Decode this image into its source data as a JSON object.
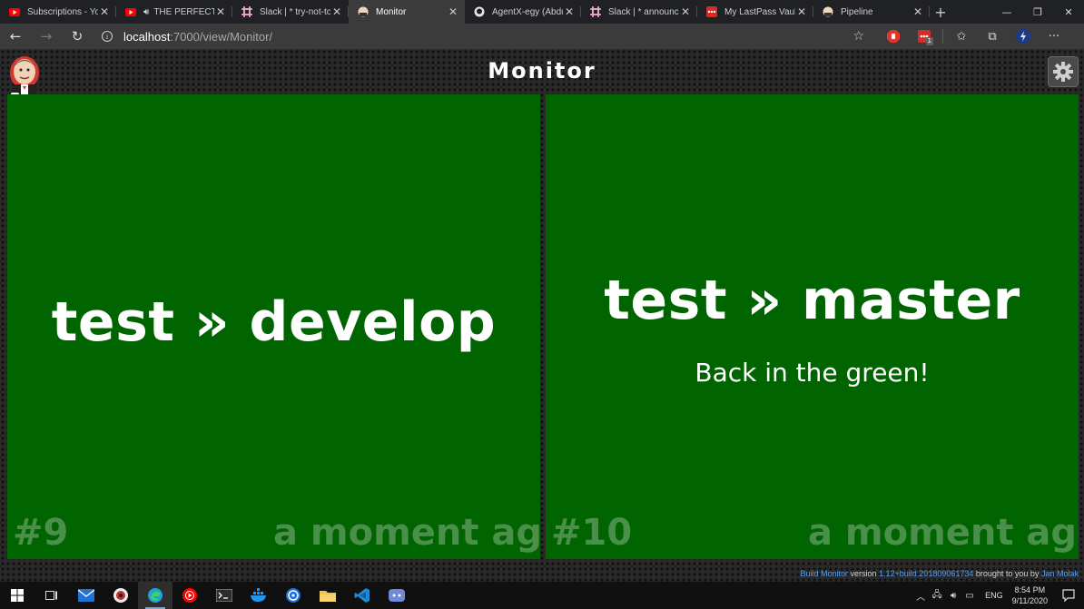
{
  "browser": {
    "tabs": [
      {
        "title": "Subscriptions - YouTube",
        "icon": "youtube-icon",
        "active": false
      },
      {
        "title": "THE PERFECT",
        "icon": "youtube-icon",
        "active": false,
        "audio": true
      },
      {
        "title": "Slack | * try-not-to",
        "icon": "slack-icon",
        "active": false
      },
      {
        "title": "Monitor",
        "icon": "jenkins-icon",
        "active": true
      },
      {
        "title": "AgentX-egy (Abdu",
        "icon": "github-icon",
        "active": false
      },
      {
        "title": "Slack | * announcements",
        "icon": "slack-icon",
        "active": false
      },
      {
        "title": "My LastPass Vault",
        "icon": "lastpass-icon",
        "active": false
      },
      {
        "title": "Pipeline",
        "icon": "jenkins-icon",
        "active": false
      }
    ],
    "url_host": "localhost",
    "url_rest": ":7000/view/Monitor/",
    "extension_badge": "1"
  },
  "monitor": {
    "title": "Monitor",
    "jobs": [
      {
        "name": "test » develop",
        "message": "",
        "build": "#9",
        "time": "a moment ago",
        "status_color": "#006400"
      },
      {
        "name": "test » master",
        "message": "Back in the green!",
        "build": "#10",
        "time": "a moment ago",
        "status_color": "#006400"
      }
    ],
    "footer": {
      "product": "Build Monitor",
      "version_label": "version",
      "version": "1.12+build.201809061734",
      "brought_by": "brought to you by",
      "author": "Jan Molak"
    }
  },
  "taskbar": {
    "language": "ENG",
    "time": "8:54 PM",
    "date": "9/11/2020"
  },
  "colors": {
    "success": "#006400",
    "link": "#5aa0f0"
  }
}
